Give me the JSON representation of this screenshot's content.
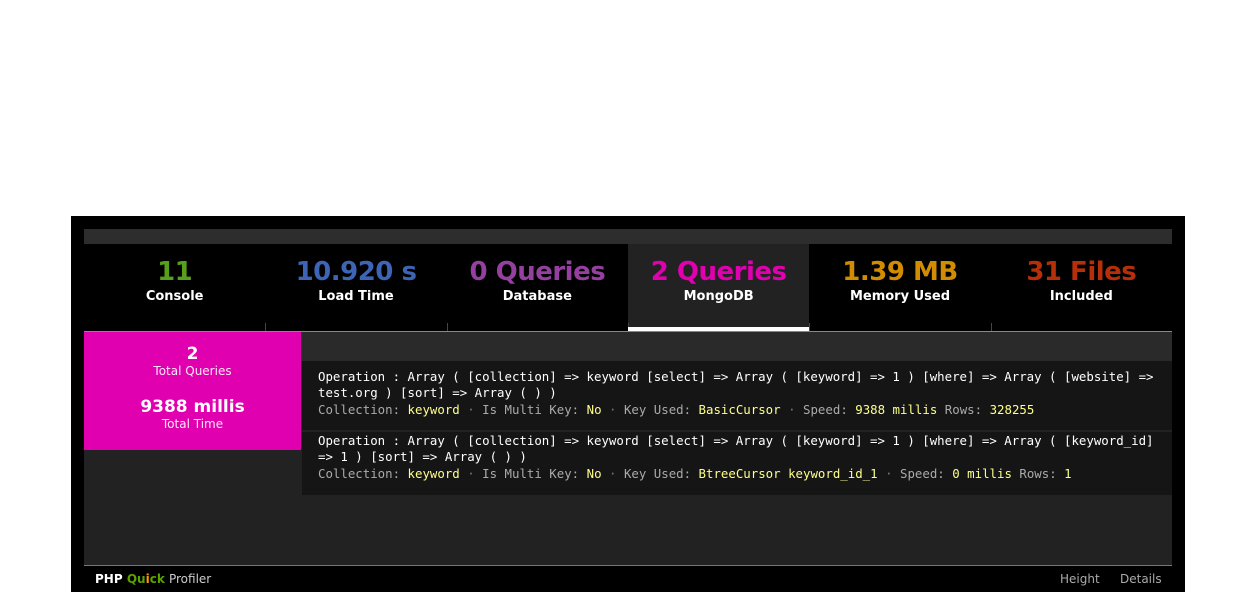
{
  "tabs": [
    {
      "value": "11",
      "label": "Console",
      "color": "#589f1b"
    },
    {
      "value": "10.920 s",
      "label": "Load Time",
      "color": "#3d64b5"
    },
    {
      "value": "0 Queries",
      "label": "Database",
      "color": "#953fa1"
    },
    {
      "value": "2 Queries",
      "label": "MongoDB",
      "color": "#e000b0",
      "active": true
    },
    {
      "value": "1.39 MB",
      "label": "Memory Used",
      "color": "#d28c00"
    },
    {
      "value": "31 Files",
      "label": "Included",
      "color": "#b72f09"
    }
  ],
  "summary": {
    "count": "2",
    "count_label": "Total Queries",
    "time": "9388 millis",
    "time_label": "Total Time"
  },
  "queries": [
    {
      "operation": "Operation : Array ( [collection] => keyword [select] => Array ( [keyword] => 1 ) [where] => Array ( [website] => test.org ) [sort] => Array ( ) )",
      "collection_label": "Collection:",
      "collection": "keyword",
      "multikey_label": "Is Multi Key:",
      "multikey": "No",
      "keyused_label": "Key Used:",
      "keyused": "BasicCursor",
      "speed_label": "Speed:",
      "speed": "9388 millis",
      "rows_label": "Rows:",
      "rows": "328255"
    },
    {
      "operation": "Operation : Array ( [collection] => keyword [select] => Array ( [keyword] => 1 ) [where] => Array ( [keyword_id] => 1 ) [sort] => Array ( ) )",
      "collection_label": "Collection:",
      "collection": "keyword",
      "multikey_label": "Is Multi Key:",
      "multikey": "No",
      "keyused_label": "Key Used:",
      "keyused": "BtreeCursor keyword_id_1",
      "speed_label": "Speed:",
      "speed": "0 millis",
      "rows_label": "Rows:",
      "rows": "1"
    }
  ],
  "footer": {
    "brand_php": "PHP",
    "brand_qu": "Qu",
    "brand_i": "i",
    "brand_ck": "ck",
    "brand_profiler": "Profiler",
    "height_link": "Height",
    "details_link": "Details"
  }
}
